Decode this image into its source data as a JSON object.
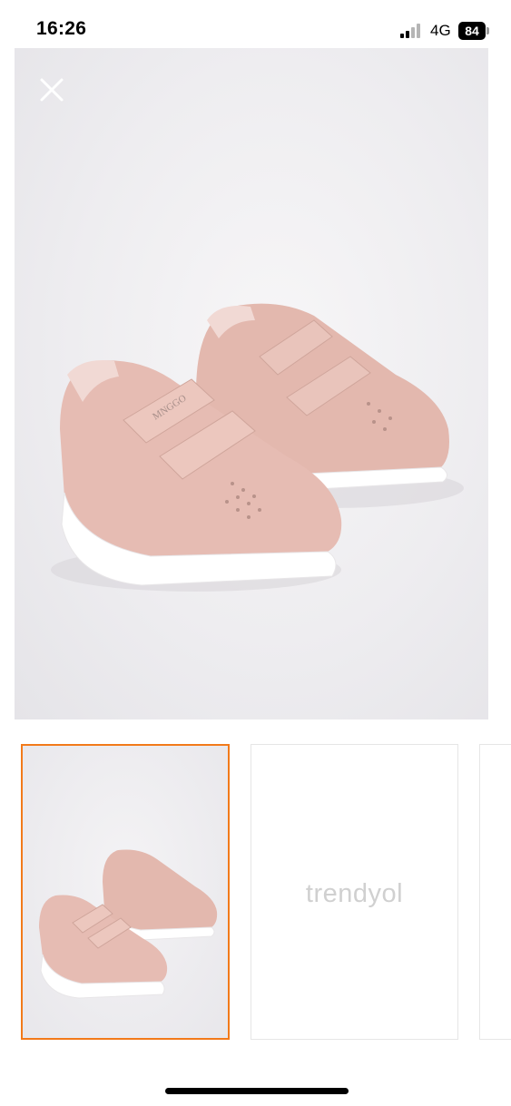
{
  "status_bar": {
    "time": "16:26",
    "network": "4G",
    "battery": "84"
  },
  "main_image": {
    "alt": "Pink velcro kids sneakers with white sole",
    "shoe_color": "#e6bcb3",
    "sole_color": "#ffffff",
    "shoe_brand_print": "MNGGO"
  },
  "gallery": {
    "selected_border_color": "#f27a1a",
    "placeholder_brand": "trendyol"
  },
  "icons": {
    "close": "close-icon",
    "signal": "signal-icon"
  }
}
